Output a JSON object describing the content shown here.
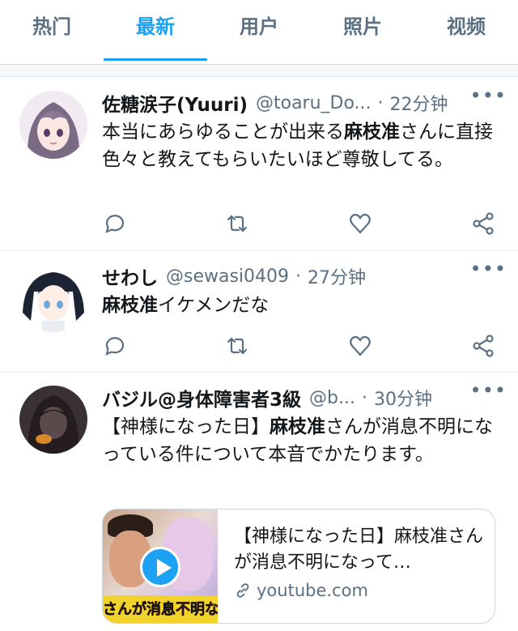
{
  "tabs": [
    {
      "label": "热门",
      "active": false
    },
    {
      "label": "最新",
      "active": true
    },
    {
      "label": "用户",
      "active": false
    },
    {
      "label": "照片",
      "active": false
    },
    {
      "label": "视频",
      "active": false
    }
  ],
  "tweets": [
    {
      "name": "佐糖涙子(Yuuri)",
      "handle": "@toaru_Do...",
      "separator": "·",
      "time": "22分钟",
      "more": "•••",
      "text_parts": [
        "本当にあらゆることが出来る",
        "麻枝准",
        "さんに直接色々と教えてもらいたいほど尊敬してる。"
      ]
    },
    {
      "name": "せわし",
      "handle": "@sewasi0409",
      "separator": "·",
      "time": "27分钟",
      "more": "•••",
      "text_parts": [
        "麻枝准",
        "イケメンだな"
      ]
    },
    {
      "name": "バジル@身体障害者3級",
      "handle": "@b...",
      "separator": "·",
      "time": "30分钟",
      "more": "•••",
      "text_parts": [
        "【神様になった日】",
        "麻枝准",
        "さんが消息不明になっている件について本音でかたります。"
      ],
      "card": {
        "title": "【神様になった日】麻枝准さんが消息不明になって…",
        "domain": "youtube.com",
        "thumb_caption": "さんが消息不明な件に"
      }
    }
  ],
  "icons": {
    "reply": "reply-icon",
    "retweet": "retweet-icon",
    "like": "like-icon",
    "share": "share-icon",
    "link": "link-icon",
    "play": "play-icon"
  },
  "colors": {
    "accent": "#1da1f2",
    "secondary_text": "#5b7083",
    "primary_text": "#14171a"
  }
}
